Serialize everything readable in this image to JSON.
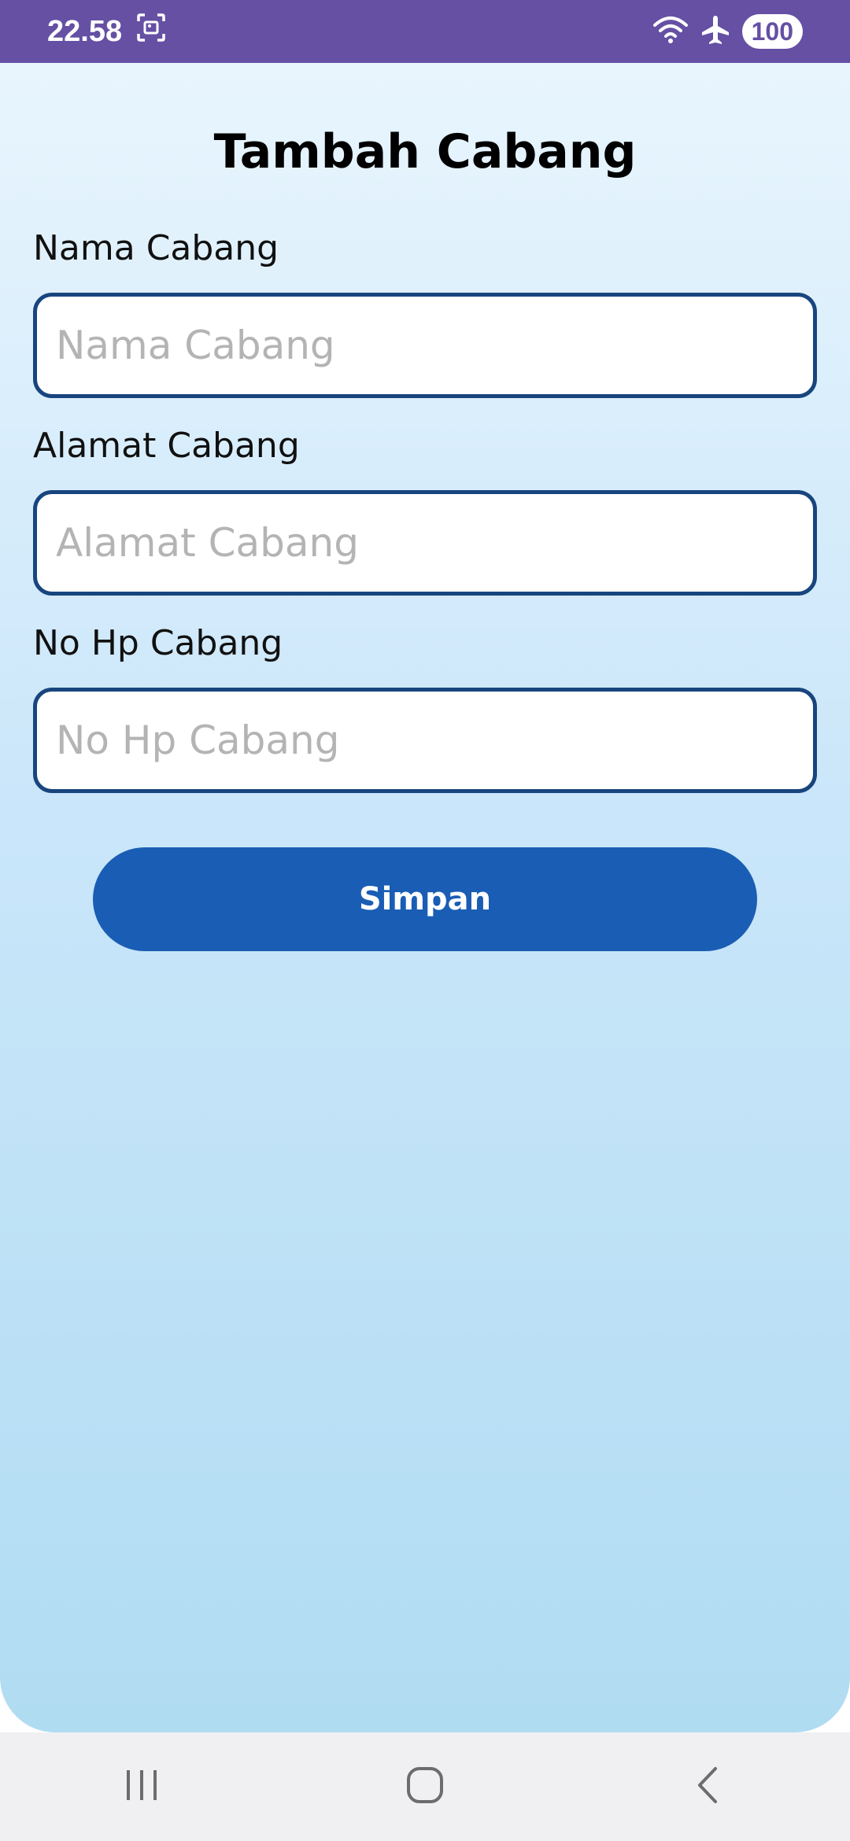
{
  "status_bar": {
    "time": "22.58",
    "battery": "100",
    "background_color": "#6550a4",
    "icons": [
      "screenshot-icon",
      "wifi-icon",
      "airplane-icon"
    ]
  },
  "page": {
    "title": "Tambah Cabang"
  },
  "form": {
    "fields": [
      {
        "label": "Nama Cabang",
        "placeholder": "Nama Cabang",
        "value": ""
      },
      {
        "label": "Alamat Cabang",
        "placeholder": "Alamat Cabang",
        "value": ""
      },
      {
        "label": "No Hp Cabang",
        "placeholder": "No Hp Cabang",
        "value": ""
      }
    ],
    "submit_label": "Simpan",
    "border_color": "#18457e",
    "button_color": "#1a5db4"
  },
  "nav_bar": {
    "buttons": [
      "recent-apps-icon",
      "home-icon",
      "back-icon"
    ]
  }
}
